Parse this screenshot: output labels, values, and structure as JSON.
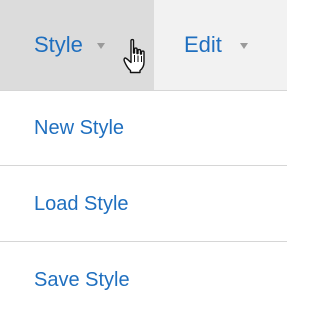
{
  "menubar": {
    "tabs": [
      {
        "label": "Style",
        "active": true
      },
      {
        "label": "Edit",
        "active": false
      }
    ]
  },
  "dropdown": {
    "items": [
      {
        "label": "New Style"
      },
      {
        "label": "Load Style"
      },
      {
        "label": "Save Style"
      }
    ]
  },
  "colors": {
    "link_blue": "#1f6fbf",
    "menubar_bg": "#f2f2f2",
    "active_tab_bg": "#dcdcdc",
    "divider": "#d6d6d6",
    "caret": "#9a9a9a"
  },
  "icons": {
    "caret": "chevron-down-icon",
    "cursor": "hand-pointer-icon"
  }
}
